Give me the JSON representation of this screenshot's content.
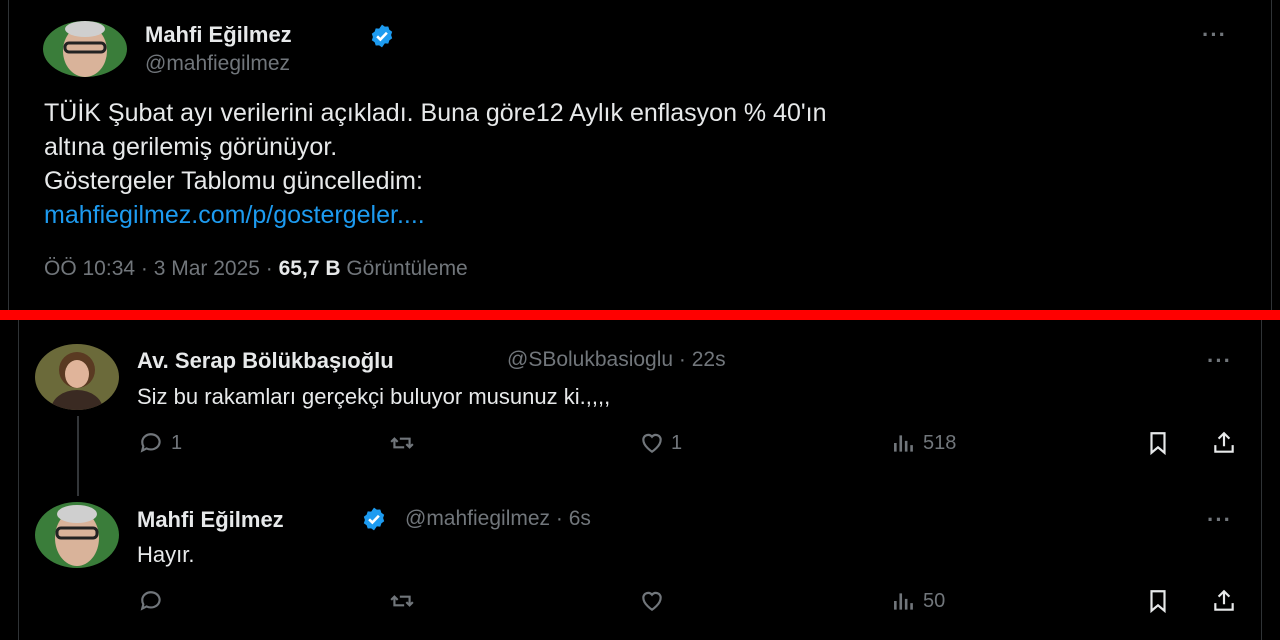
{
  "main_tweet": {
    "author_name": "Mahfi Eğilmez",
    "author_handle": "@mahfiegilmez",
    "text_lines": [
      "TÜİK Şubat ayı verilerini açıkladı. Buna göre12 Aylık enflasyon % 40'ın",
      "altına gerilemiş görünüyor.",
      "Göstergeler Tablomu güncelledim:"
    ],
    "link": "mahfiegilmez.com/p/gostergeler....",
    "time": "ÖÖ 10:34 · 3 Mar 2025 ·",
    "views_count": "65,7 B",
    "views_label": "Görüntüleme",
    "more": "···"
  },
  "replies": [
    {
      "author_name": "Av. Serap Bölükbaşıoğlu",
      "author_handle": "@SBolukbasioglu · 22s",
      "text": "Siz bu rakamları gerçekçi buluyor musunuz ki.,,,,",
      "reply_count": "1",
      "retweet_count": "",
      "like_count": "1",
      "view_count": "518",
      "more": "···"
    },
    {
      "author_name": "Mahfi Eğilmez",
      "author_handle": "@mahfiegilmez · 6s",
      "text": "Hayır.",
      "reply_count": "",
      "retweet_count": "",
      "like_count": "",
      "view_count": "50",
      "more": "···"
    }
  ],
  "colors": {
    "background": "#000000",
    "accent_link": "#1d9bf0",
    "divider": "#ff0000",
    "muted": "#71767b"
  }
}
